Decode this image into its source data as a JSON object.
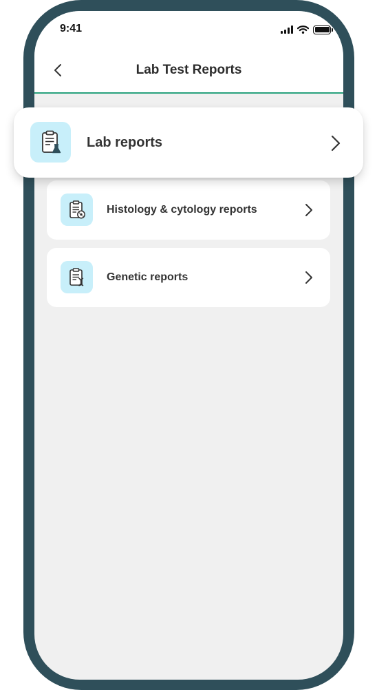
{
  "status_bar": {
    "time": "9:41",
    "icons": [
      "signal-icon",
      "wifi-icon",
      "battery-icon"
    ]
  },
  "header": {
    "title": "Lab Test Reports",
    "back_icon": "chevron-left-icon"
  },
  "items": [
    {
      "label": "Lab reports",
      "icon": "clipboard-flask-icon",
      "highlighted": true
    },
    {
      "label": "Histology & cytology reports",
      "icon": "clipboard-cell-icon"
    },
    {
      "label": "Genetic reports",
      "icon": "clipboard-dna-icon"
    }
  ],
  "colors": {
    "frame": "#2f4f5a",
    "accent": "#27a17c",
    "icon_tile": "#c8effa",
    "screen_background": "#f0f0f0"
  }
}
